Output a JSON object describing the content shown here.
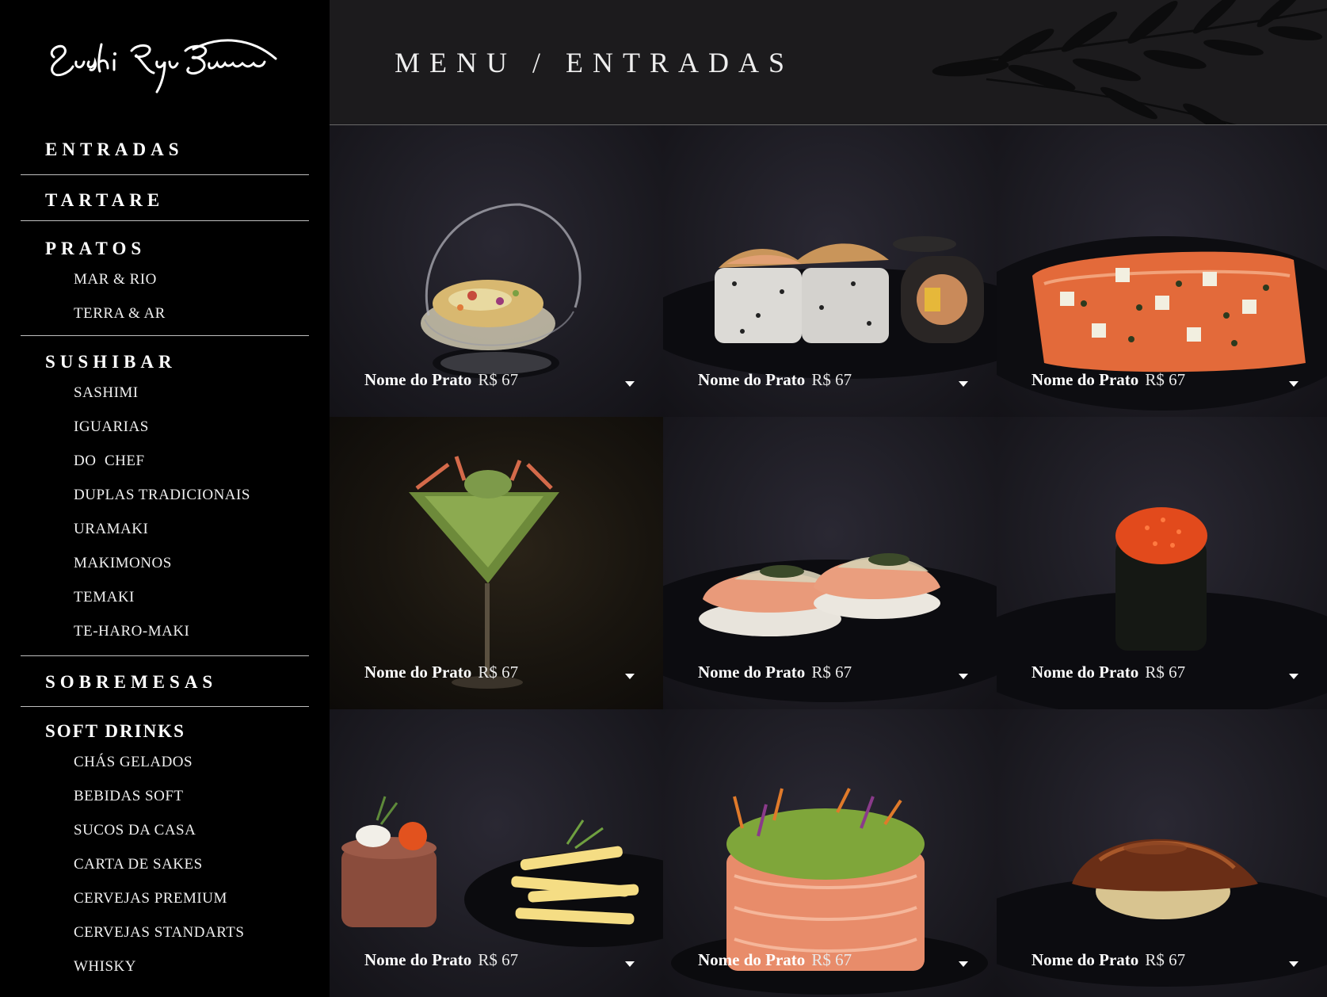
{
  "brand": {
    "logo_text": "Sushi Ruy Barbosa"
  },
  "header": {
    "breadcrumb_root": "MENU",
    "separator": "/",
    "breadcrumb_current": "ENTRADAS"
  },
  "sidebar": {
    "sections": [
      {
        "label": "ENTRADAS",
        "items": []
      },
      {
        "label": "TARTARE",
        "items": []
      },
      {
        "label": "PRATOS",
        "items": [
          "MAR & RIO",
          "TERRA & AR"
        ]
      },
      {
        "label": "SUSHIBAR",
        "items": [
          "SASHIMI",
          "IGUARIAS",
          "DO  CHEF",
          "DUPLAS TRADICIONAIS",
          "URAMAKI",
          "MAKIMONOS",
          "TEMAKI",
          "TE-HARO-MAKI"
        ]
      },
      {
        "label": "SOBREMESAS",
        "items": []
      },
      {
        "label": "SOFT DRINKS",
        "items": [
          "CHÁS GELADOS",
          "BEBIDAS SOFT",
          "SUCOS DA CASA",
          "CARTA DE SAKES",
          "CERVEJAS PREMIUM",
          "CERVEJAS STANDARTS",
          "WHISKY"
        ]
      }
    ]
  },
  "dishes": [
    {
      "name": "Nome do Prato",
      "price": "R$ 67",
      "photo": "ceviche-glass-bowl"
    },
    {
      "name": "Nome do Prato",
      "price": "R$ 67",
      "photo": "uramaki-crispy-topping"
    },
    {
      "name": "Nome do Prato",
      "price": "R$ 67",
      "photo": "salmon-carpaccio"
    },
    {
      "name": "Nome do Prato",
      "price": "R$ 67",
      "photo": "salad-martini-glass"
    },
    {
      "name": "Nome do Prato",
      "price": "R$ 67",
      "photo": "seared-salmon-nigiri"
    },
    {
      "name": "Nome do Prato",
      "price": "R$ 67",
      "photo": "tobiko-gunkan"
    },
    {
      "name": "Nome do Prato",
      "price": "R$ 67",
      "photo": "tartare-with-fries"
    },
    {
      "name": "Nome do Prato",
      "price": "R$ 67",
      "photo": "salmon-wrapped-salad"
    },
    {
      "name": "Nome do Prato",
      "price": "R$ 67",
      "photo": "unagi-nigiri"
    }
  ],
  "colors": {
    "background": "#000000",
    "header_bg": "#1c1b1d",
    "divider": "#bfbfbf",
    "text": "#ffffff"
  },
  "icons": {
    "dropdown": "caret-down-icon",
    "decoration": "leaf-branch-icon"
  }
}
